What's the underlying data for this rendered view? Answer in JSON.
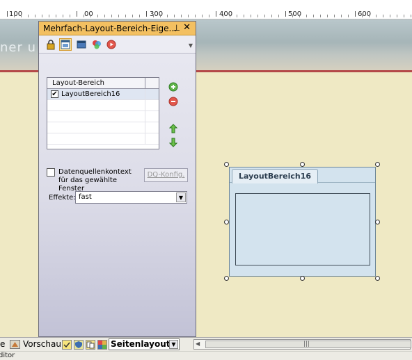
{
  "ruler": {
    "labels": [
      "100",
      "00",
      "300",
      "400",
      "500",
      "600"
    ]
  },
  "banner": {
    "text": "ner u"
  },
  "panel": {
    "title": "Mehrfach-Layout-Bereich-Eige...",
    "pin_glyph": "⊥",
    "close_glyph": "✕",
    "toolbar_icons": [
      "lock-icon",
      "layout-properties-icon",
      "window-icon",
      "colors-icon",
      "play-icon"
    ],
    "list": {
      "header": "Layout-Bereich",
      "items": [
        {
          "label": "LayoutBereich16",
          "checked": true
        }
      ]
    },
    "datasource": {
      "label": "Datenquellenkontext für das gewählte Fenster",
      "checked": false
    },
    "dq_button": "DQ-Konfig.",
    "effects": {
      "label": "Effekte:",
      "value": "fast"
    }
  },
  "canvas": {
    "tab_label": "LayoutBereich16"
  },
  "bottombar": {
    "preview_label": "Vorschau",
    "layout_select": "Seitenlayout",
    "edge_label": "e"
  },
  "editor": {
    "label": "ditor"
  },
  "colors": {
    "panel_title": "#f3c061",
    "canvas": "#efe9c4",
    "layout_area": "#d3e3ee",
    "accent_red": "#b44848"
  }
}
